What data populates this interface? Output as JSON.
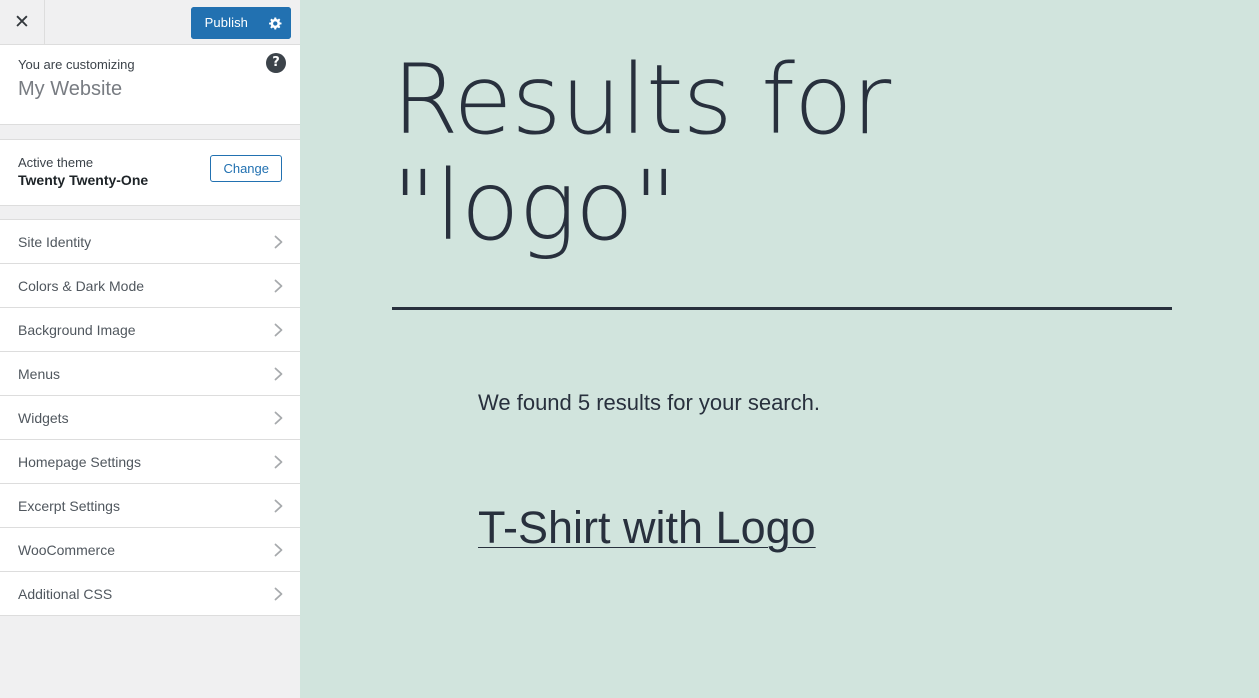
{
  "customizer": {
    "close_icon": "close-icon",
    "publish_label": "Publish",
    "gear_icon": "gear-icon",
    "help_icon": "help-icon",
    "help_glyph": "?",
    "customizing_label": "You are customizing",
    "site_name": "My Website",
    "theme": {
      "active_label": "Active theme",
      "name": "Twenty Twenty-One",
      "change_label": "Change"
    },
    "accent_color": "#2271b1",
    "sections": [
      {
        "label": "Site Identity",
        "chevron": "chevron-right-icon"
      },
      {
        "label": "Colors & Dark Mode",
        "chevron": "chevron-right-icon"
      },
      {
        "label": "Background Image",
        "chevron": "chevron-right-icon"
      },
      {
        "label": "Menus",
        "chevron": "chevron-right-icon"
      },
      {
        "label": "Widgets",
        "chevron": "chevron-right-icon"
      },
      {
        "label": "Homepage Settings",
        "chevron": "chevron-right-icon"
      },
      {
        "label": "Excerpt Settings",
        "chevron": "chevron-right-icon"
      },
      {
        "label": "WooCommerce",
        "chevron": "chevron-right-icon"
      },
      {
        "label": "Additional CSS",
        "chevron": "chevron-right-icon"
      }
    ]
  },
  "preview": {
    "background_color": "#d1e4dd",
    "text_color": "#28303d",
    "page_title": "Results for \"logo\"",
    "results_count": "We found 5 results for your search.",
    "entry_title": "T-Shirt with Logo"
  }
}
